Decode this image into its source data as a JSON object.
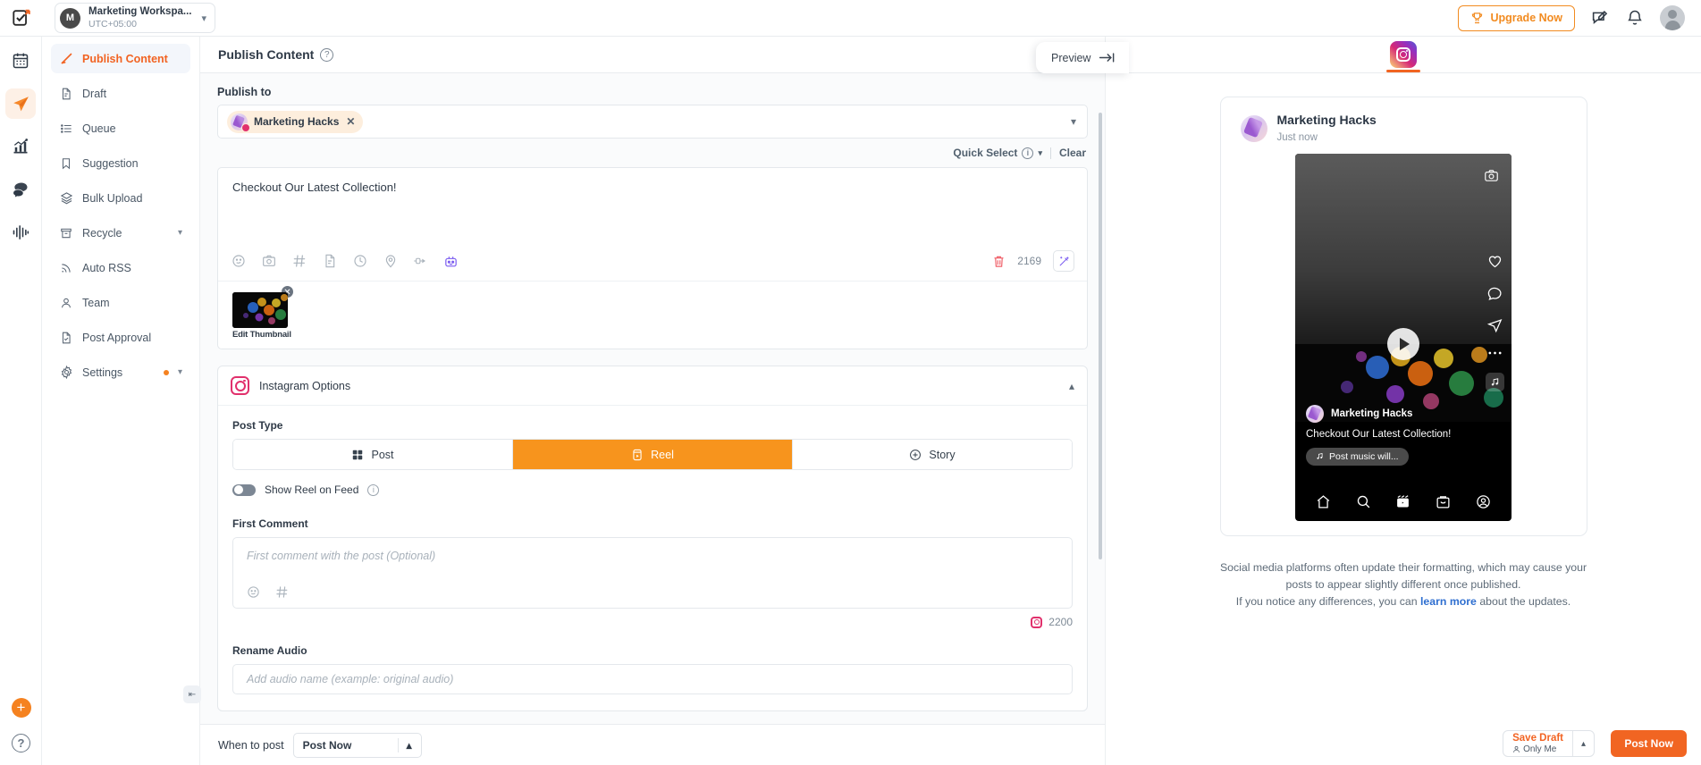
{
  "topbar": {
    "workspace_name": "Marketing Workspa...",
    "workspace_initial": "M",
    "timezone": "UTC+05:00",
    "upgrade_label": "Upgrade Now"
  },
  "rail": {
    "items": [
      {
        "icon": "tasks-icon",
        "label": "Tasks"
      },
      {
        "icon": "calendar-icon",
        "label": "Calendar"
      },
      {
        "icon": "publish-icon",
        "label": "Publish",
        "active": true
      },
      {
        "icon": "analytics-icon",
        "label": "Analytics"
      },
      {
        "icon": "inbox-icon",
        "label": "Inbox"
      },
      {
        "icon": "audio-wave-icon",
        "label": "Listening"
      }
    ],
    "add_label": "+",
    "help_label": "?"
  },
  "sidebar": {
    "items": [
      {
        "label": "Publish Content",
        "icon": "pencil-icon",
        "active": true,
        "chevron": false,
        "dot": false
      },
      {
        "label": "Draft",
        "icon": "document-icon",
        "active": false,
        "chevron": false,
        "dot": false
      },
      {
        "label": "Queue",
        "icon": "list-icon",
        "active": false,
        "chevron": false,
        "dot": false
      },
      {
        "label": "Suggestion",
        "icon": "bookmark-icon",
        "active": false,
        "chevron": false,
        "dot": false
      },
      {
        "label": "Bulk Upload",
        "icon": "layers-icon",
        "active": false,
        "chevron": false,
        "dot": false
      },
      {
        "label": "Recycle",
        "icon": "archive-icon",
        "active": false,
        "chevron": true,
        "dot": false
      },
      {
        "label": "Auto RSS",
        "icon": "rss-icon",
        "active": false,
        "chevron": false,
        "dot": false
      },
      {
        "label": "Team",
        "icon": "user-icon",
        "active": false,
        "chevron": false,
        "dot": false
      },
      {
        "label": "Post Approval",
        "icon": "doc-check-icon",
        "active": false,
        "chevron": false,
        "dot": false
      },
      {
        "label": "Settings",
        "icon": "gear-icon",
        "active": false,
        "chevron": true,
        "dot": true
      }
    ]
  },
  "center": {
    "title": "Publish Content",
    "publish_to_label": "Publish to",
    "account_chip": "Marketing Hacks",
    "quick_select_label": "Quick Select",
    "clear_label": "Clear",
    "composer_text": "Checkout Our Latest Collection!",
    "char_count": "2169",
    "edit_thumbnail_label": "Edit Thumbnail"
  },
  "instagram_options": {
    "card_title": "Instagram Options",
    "post_type_label": "Post Type",
    "post_types": [
      {
        "label": "Post",
        "icon": "grid-icon",
        "active": false
      },
      {
        "label": "Reel",
        "icon": "reel-icon",
        "active": true
      },
      {
        "label": "Story",
        "icon": "plus-circle-icon",
        "active": false
      }
    ],
    "show_reel_label": "Show Reel on Feed",
    "first_comment_label": "First Comment",
    "first_comment_placeholder": "First comment with the post (Optional)",
    "first_comment_count": "2200",
    "rename_audio_label": "Rename Audio",
    "rename_audio_placeholder": "Add audio name (example: original audio)"
  },
  "bottom": {
    "when_to_post_label": "When to post",
    "when_to_post_value": "Post Now",
    "save_draft_label": "Save Draft",
    "save_draft_sub": "Only Me",
    "post_now_label": "Post Now"
  },
  "preview": {
    "float_label": "Preview",
    "tab": "instagram-tab",
    "account_name": "Marketing Hacks",
    "timestamp": "Just now",
    "caption_name": "Marketing Hacks",
    "caption_text": "Checkout Our Latest Collection!",
    "music_chip": "Post music will...",
    "note_line1": "Social media platforms often update their formatting, which may cause your",
    "note_line2": "posts to appear slightly different once published.",
    "note_line3_a": "If you notice any differences, you can ",
    "note_link": "learn more",
    "note_line3_b": " about the updates."
  },
  "colors": {
    "accent_orange": "#f16522",
    "instagram_pink": "#e1306c",
    "reel_active": "#f7941d",
    "link_blue": "#2f6fd0"
  }
}
